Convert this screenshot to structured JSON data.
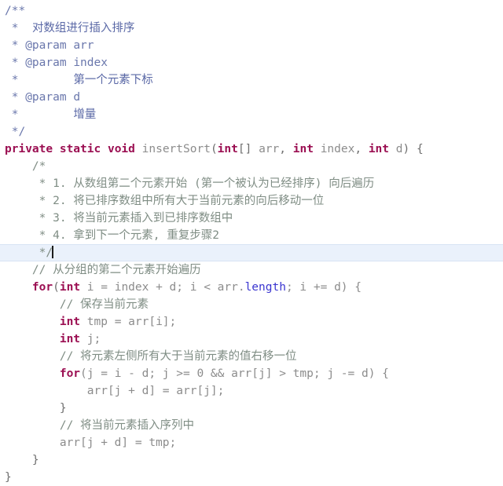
{
  "editor": {
    "language": "java",
    "theme": "light",
    "colors": {
      "background": "#ffffff",
      "keyword": "#9b0f52",
      "identifier": "#8c8c8c",
      "field": "#3a35d0",
      "javadoc": "#6a77ac",
      "comment": "#7f8d84",
      "caret_line": "#eaf1fb"
    }
  },
  "code": {
    "javadoc": {
      "open": "/**",
      "l1_star": "*",
      "l1_text": "对数组进行插入排序",
      "l2_star": "*",
      "l2_tag": "@param",
      "l2_name": "arr",
      "l3_star": "*",
      "l3_tag": "@param",
      "l3_name": "index",
      "l4_star": "*",
      "l4_text": "第一个元素下标",
      "l5_star": "*",
      "l5_tag": "@param",
      "l5_name": "d",
      "l6_star": "*",
      "l6_text": "增量",
      "close": "*/"
    },
    "signature": {
      "kw_private": "private",
      "kw_static": "static",
      "kw_void": "void",
      "name": "insertSort",
      "paren_open": "(",
      "p1_type": "int",
      "p1_brackets": "[]",
      "p1_name": "arr",
      "comma1": ",",
      "p2_type": "int",
      "p2_name": "index",
      "comma2": ",",
      "p3_type": "int",
      "p3_name": "d",
      "paren_close": ")",
      "brace_open": "{"
    },
    "steps_comment": {
      "open": "/*",
      "s1": "* 1. 从数组第二个元素开始 (第一个被认为已经排序) 向后遍历",
      "s2": "* 2. 将已排序数组中所有大于当前元素的向后移动一位",
      "s3": "* 3. 将当前元素插入到已排序数组中",
      "s4": "* 4. 拿到下一个元素, 重复步骤2",
      "close": "*/"
    },
    "body": {
      "c_outer_loop": "// 从分组的第二个元素开始遍历",
      "for_kw": "for",
      "for_open": "(",
      "for_int": "int",
      "for_init": " i = index + d; i < arr.",
      "for_length": "length",
      "for_rest": "; i += d) {",
      "c_save": "// 保存当前元素",
      "tmp_kw": "int",
      "tmp_rest": " tmp = arr[i];",
      "j_kw": "int",
      "j_rest": " j;",
      "c_shift": "// 将元素左侧所有大于当前元素的值右移一位",
      "inner_for_kw": "for",
      "inner_for_rest": "(j = i - d; j >= 0 && arr[j] > tmp; j -= d) {",
      "shift_stmt": "arr[j + d] = arr[j];",
      "inner_close": "}",
      "c_insert": "// 将当前元素插入序列中",
      "insert_stmt": "arr[j + d] = tmp;",
      "outer_close": "}",
      "method_close": "}"
    }
  }
}
